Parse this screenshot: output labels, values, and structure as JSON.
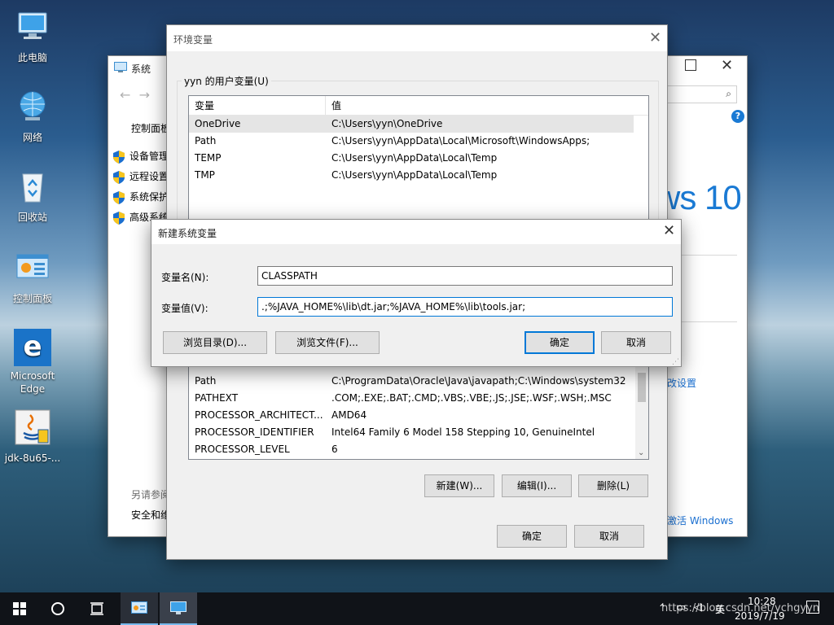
{
  "desktop": {
    "icons": [
      {
        "label": "此电脑",
        "icon": "computer-icon"
      },
      {
        "label": "网络",
        "icon": "network-icon"
      },
      {
        "label": "回收站",
        "icon": "recycle-bin-icon"
      },
      {
        "label": "控制面板",
        "icon": "control-panel-icon"
      },
      {
        "label": "Microsoft Edge",
        "icon": "edge-icon"
      },
      {
        "label": "jdk-8u65-...",
        "icon": "java-installer-icon"
      }
    ]
  },
  "system_window": {
    "title": "系统",
    "nav_link": "控制面板",
    "side_links": [
      "设备管理",
      "远程设置",
      "系统保护",
      "高级系统"
    ],
    "brand_text": "ws 10",
    "change_settings": "改设置",
    "activate": "激活 Windows",
    "see_also": "另请参阅",
    "security": "安全和维"
  },
  "env_window": {
    "title": "环境变量",
    "user_group_label": "yyn 的用户变量(U)",
    "columns": [
      "变量",
      "值"
    ],
    "user_vars": [
      {
        "name": "OneDrive",
        "value": "C:\\Users\\yyn\\OneDrive"
      },
      {
        "name": "Path",
        "value": "C:\\Users\\yyn\\AppData\\Local\\Microsoft\\WindowsApps;"
      },
      {
        "name": "TEMP",
        "value": "C:\\Users\\yyn\\AppData\\Local\\Temp"
      },
      {
        "name": "TMP",
        "value": "C:\\Users\\yyn\\AppData\\Local\\Temp"
      }
    ],
    "system_vars": [
      {
        "name": "Path",
        "value": "C:\\ProgramData\\Oracle\\Java\\javapath;C:\\Windows\\system32;..."
      },
      {
        "name": "PATHEXT",
        "value": ".COM;.EXE;.BAT;.CMD;.VBS;.VBE;.JS;.JSE;.WSF;.WSH;.MSC"
      },
      {
        "name": "PROCESSOR_ARCHITECT...",
        "value": "AMD64"
      },
      {
        "name": "PROCESSOR_IDENTIFIER",
        "value": "Intel64 Family 6 Model 158 Stepping 10, GenuineIntel"
      },
      {
        "name": "PROCESSOR_LEVEL",
        "value": "6"
      }
    ],
    "new_button": "新建(W)...",
    "edit_button": "编辑(I)...",
    "delete_button": "删除(L)",
    "ok_button": "确定",
    "cancel_button": "取消"
  },
  "new_var_dialog": {
    "title": "新建系统变量",
    "name_label": "变量名(N):",
    "name_value": "CLASSPATH",
    "value_label": "变量值(V):",
    "value_value": ".;%JAVA_HOME%\\lib\\dt.jar;%JAVA_HOME%\\lib\\tools.jar;",
    "browse_dir": "浏览目录(D)...",
    "browse_file": "浏览文件(F)...",
    "ok": "确定",
    "cancel": "取消"
  },
  "taskbar": {
    "tray_text": "英",
    "time": "10:28",
    "date": "2019/7/19",
    "watermark": "https://blog.csdn.net/ychgyyn"
  },
  "colors": {
    "accent": "#0078d7",
    "win_blue": "#1a7ad4"
  }
}
